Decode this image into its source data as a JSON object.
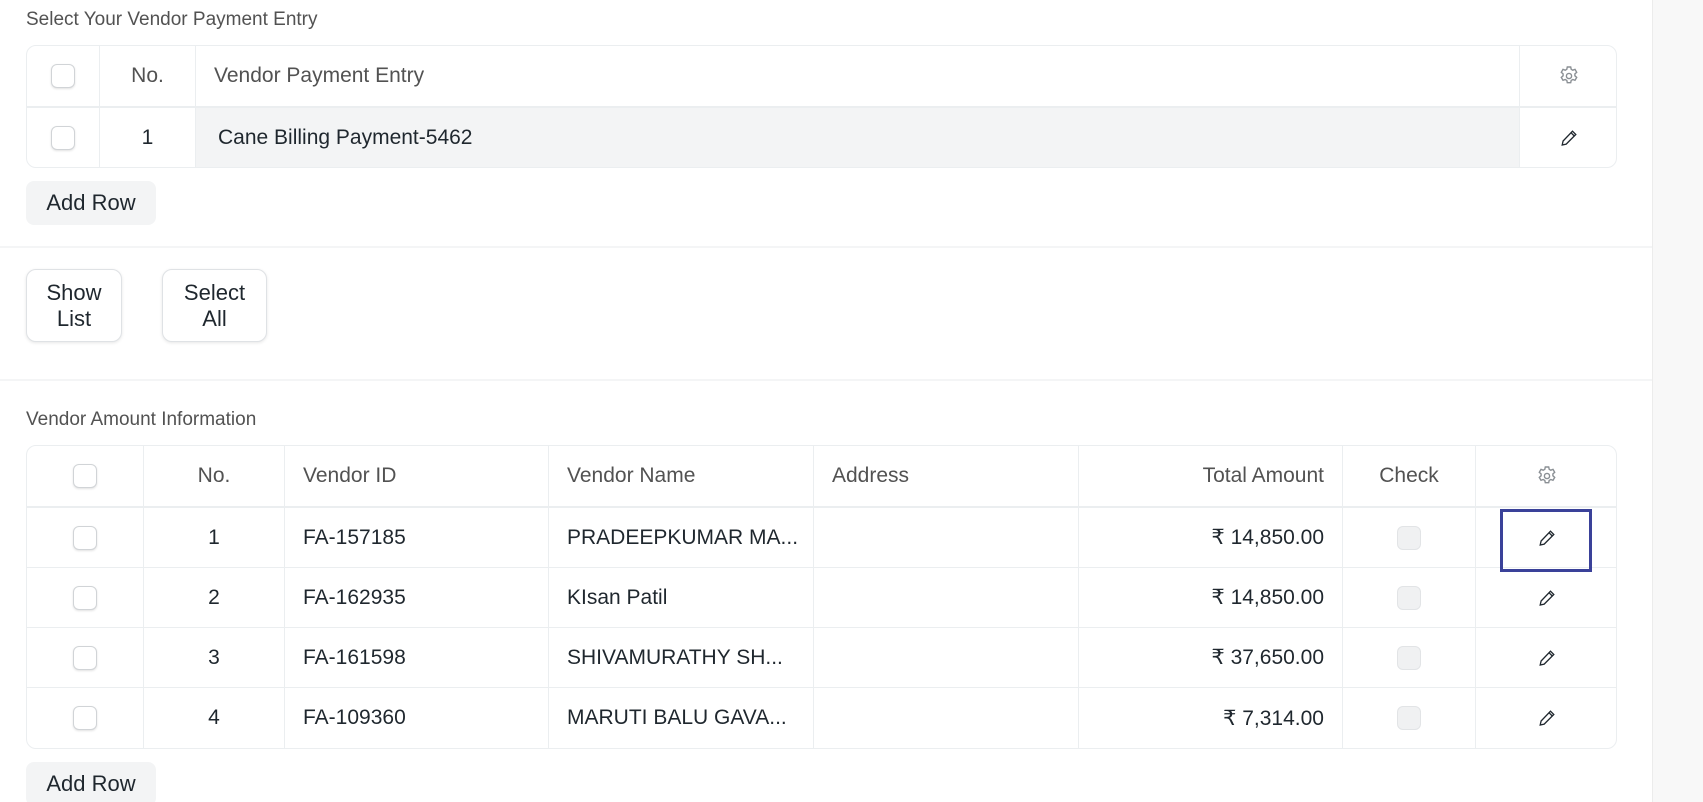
{
  "payment_section": {
    "label": "Select Your Vendor Payment Entry",
    "headers": {
      "no": "No.",
      "entry": "Vendor Payment Entry"
    },
    "rows": [
      {
        "no": "1",
        "entry": "Cane Billing Payment-5462"
      }
    ],
    "add_row_label": "Add Row"
  },
  "actions": {
    "show_list": "Show\nList",
    "select_all": "Select\nAll"
  },
  "vendor_section": {
    "label": "Vendor Amount Information",
    "headers": {
      "no": "No.",
      "vendor_id": "Vendor ID",
      "vendor_name": "Vendor Name",
      "address": "Address",
      "total_amount": "Total Amount",
      "check": "Check"
    },
    "rows": [
      {
        "no": "1",
        "vendor_id": "FA-157185",
        "vendor_name": "PRADEEPKUMAR MA...",
        "address": "",
        "total_amount": "₹ 14,850.00",
        "check": false
      },
      {
        "no": "2",
        "vendor_id": "FA-162935",
        "vendor_name": "KIsan Patil",
        "address": "",
        "total_amount": "₹ 14,850.00",
        "check": false
      },
      {
        "no": "3",
        "vendor_id": "FA-161598",
        "vendor_name": "SHIVAMURATHY SH...",
        "address": "",
        "total_amount": "₹ 37,650.00",
        "check": false
      },
      {
        "no": "4",
        "vendor_id": "FA-109360",
        "vendor_name": "MARUTI BALU GAVA...",
        "address": "",
        "total_amount": "₹ 7,314.00",
        "check": false
      }
    ],
    "add_row_label": "Add Row"
  },
  "icons": {
    "settings": "gear-icon",
    "edit": "pencil-icon"
  },
  "colors": {
    "focus_outline": "#3a4199",
    "filled_cell": "#f3f4f5",
    "border": "#ebeef0"
  }
}
